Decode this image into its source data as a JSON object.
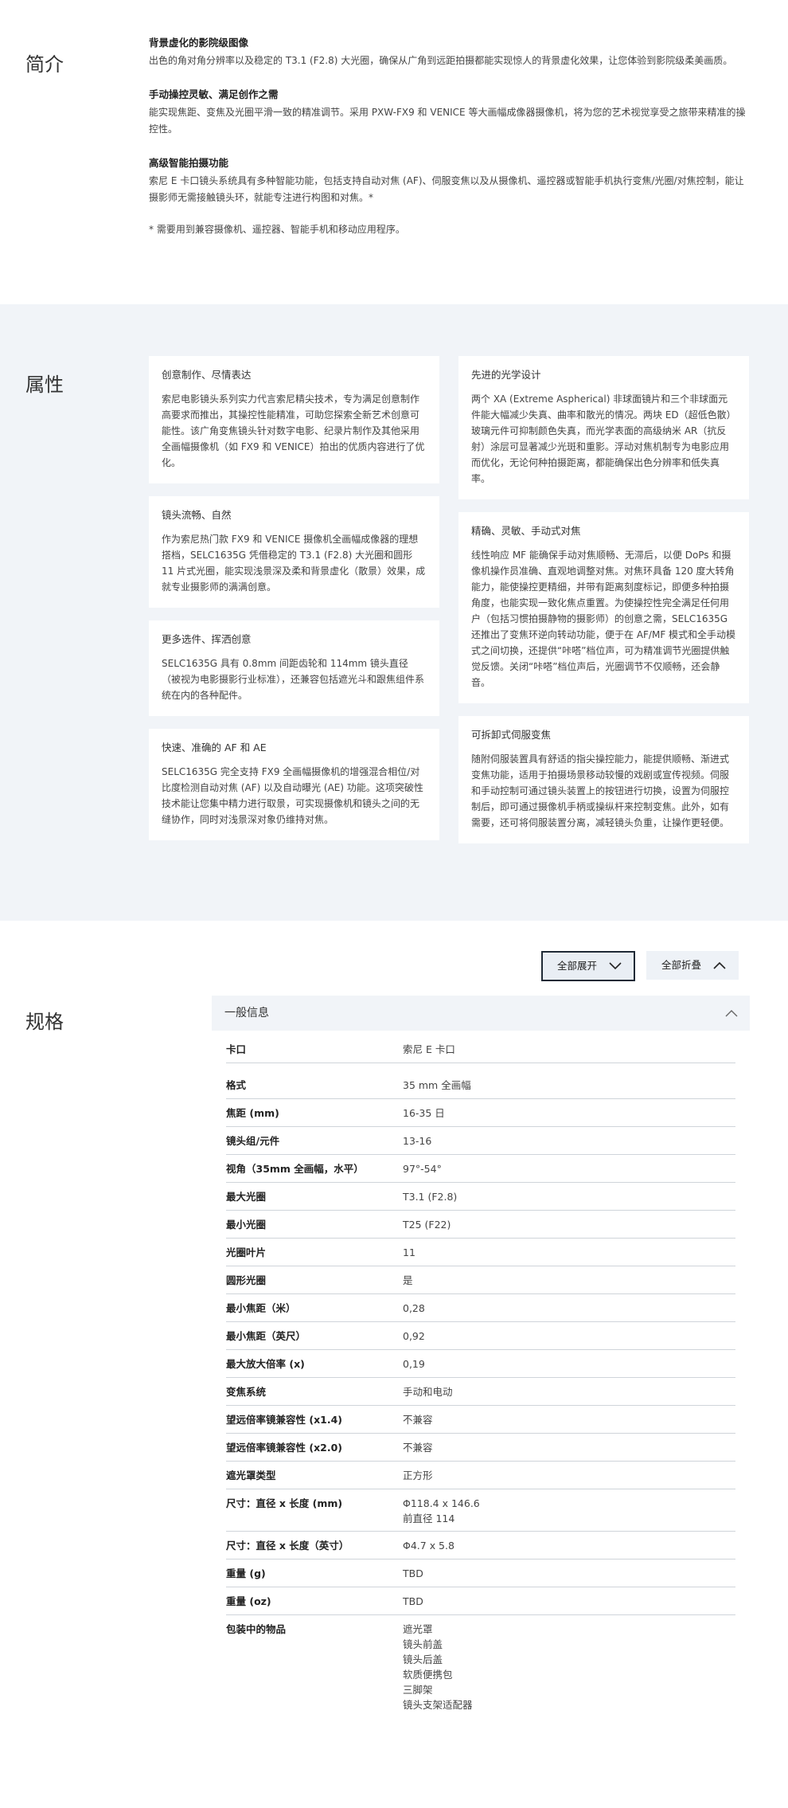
{
  "intro": {
    "title": "简介",
    "blocks": [
      {
        "heading": "背景虚化的影院级图像",
        "text": "出色的角对角分辨率以及稳定的 T3.1 (F2.8) 大光圈，确保从广角到远距拍摄都能实现惊人的背景虚化效果，让您体验到影院级柔美画质。"
      },
      {
        "heading": "手动操控灵敏、满足创作之需",
        "text": "能实现焦距、变焦及光圈平滑一致的精准调节。采用 PXW-FX9 和 VENICE 等大画幅成像器摄像机，将为您的艺术视觉享受之旅带来精准的操控性。"
      },
      {
        "heading": "高级智能拍摄功能",
        "text": "索尼 E 卡口镜头系统具有多种智能功能，包括支持自动对焦 (AF)、伺服变焦以及从摄像机、遥控器或智能手机执行变焦/光圈/对焦控制，能让摄影师无需接触镜头环，就能专注进行构图和对焦。*"
      }
    ],
    "footnote": "* 需要用到兼容摄像机、遥控器、智能手机和移动应用程序。"
  },
  "features": {
    "title": "属性",
    "left": [
      {
        "title": "创意制作、尽情表达",
        "text": "索尼电影镜头系列实力代言索尼精尖技术，专为满足创意制作高要求而推出，其操控性能精准，可助您探索全新艺术创意可能性。该广角变焦镜头针对数字电影、纪录片制作及其他采用全画幅摄像机（如 FX9 和 VENICE）拍出的优质内容进行了优化。"
      },
      {
        "title": "镜头流畅、自然",
        "text": "作为索尼热门款 FX9 和 VENICE 摄像机全画幅成像器的理想搭档，SELC1635G 凭借稳定的 T3.1 (F2.8) 大光圈和圆形 11 片式光圈，能实现浅景深及柔和背景虚化（散景）效果，成就专业摄影师的满满创意。"
      },
      {
        "title": "更多选件、挥洒创意",
        "text": "SELC1635G 具有 0.8mm 间距齿轮和 114mm 镜头直径（被视为电影摄影行业标准），还兼容包括遮光斗和跟焦组件系统在内的各种配件。"
      },
      {
        "title": "快速、准确的 AF 和 AE",
        "text": "SELC1635G 完全支持 FX9 全画幅摄像机的增强混合相位/对比度检测自动对焦 (AF) 以及自动曝光 (AE) 功能。这项突破性技术能让您集中精力进行取景，可实现摄像机和镜头之间的无缝协作，同时对浅景深对象仍维持对焦。"
      }
    ],
    "right": [
      {
        "title": "先进的光学设计",
        "text": "两个 XA (Extreme Aspherical) 非球面镜片和三个非球面元件能大幅减少失真、曲率和散光的情况。两块 ED（超低色散）玻璃元件可抑制颜色失真，而光学表面的高级纳米 AR（抗反射）涂层可显著减少光斑和重影。浮动对焦机制专为电影应用而优化，无论何种拍摄距离，都能确保出色分辨率和低失真率。"
      },
      {
        "title": "精确、灵敏、手动式对焦",
        "text": "线性响应 MF 能确保手动对焦顺畅、无滞后，以便 DoPs 和摄像机操作员准确、直观地调整对焦。对焦环具备 120 度大转角能力，能使操控更精细，并带有距离刻度标记，即便多种拍摄角度，也能实现一致化焦点重置。为使操控性完全满足任何用户（包括习惯拍摄静物的摄影师）的创意之需，SELC1635G 还推出了变焦环逆向转动功能，便于在 AF/MF 模式和全手动模式之间切换，还提供“咔嗒”档位声，可为精准调节光圈提供触觉反馈。关闭“咔嗒”档位声后，光圈调节不仅顺畅，还会静音。"
      },
      {
        "title": "可拆卸式伺服变焦",
        "text": "随附伺服装置具有舒适的指尖操控能力，能提供顺畅、渐进式变焦功能，适用于拍摄场景移动较慢的戏剧或宣传视频。伺服和手动控制可通过镜头装置上的按钮进行切换，设置为伺服控制后，即可通过摄像机手柄或操纵杆来控制变焦。此外，如有需要，还可将伺服装置分离，减轻镜头负重，让操作更轻便。"
      }
    ]
  },
  "specs": {
    "title": "规格",
    "expand_all": "全部展开",
    "collapse_all": "全部折叠",
    "group_title": "一般信息",
    "rows": [
      {
        "label": "卡口",
        "value": [
          "索尼 E 卡口"
        ]
      },
      {
        "label": "格式",
        "value": [
          "35 mm 全画幅"
        ]
      },
      {
        "label": "焦距 (mm)",
        "value": [
          "16-35 日"
        ]
      },
      {
        "label": "镜头组/元件",
        "value": [
          "13-16"
        ]
      },
      {
        "label": "视角（35mm 全画幅，水平）",
        "value": [
          "97°-54°"
        ]
      },
      {
        "label": "最大光圈",
        "value": [
          "T3.1 (F2.8)"
        ]
      },
      {
        "label": "最小光圈",
        "value": [
          "T25 (F22)"
        ]
      },
      {
        "label": "光圈叶片",
        "value": [
          "11"
        ]
      },
      {
        "label": "圆形光圈",
        "value": [
          "是"
        ]
      },
      {
        "label": "最小焦距（米）",
        "value": [
          "0,28"
        ]
      },
      {
        "label": "最小焦距（英尺）",
        "value": [
          "0,92"
        ]
      },
      {
        "label": "最大放大倍率 (x)",
        "value": [
          "0,19"
        ]
      },
      {
        "label": "变焦系统",
        "value": [
          "手动和电动"
        ]
      },
      {
        "label": "望远倍率镜兼容性 (x1.4)",
        "value": [
          "不兼容"
        ]
      },
      {
        "label": "望远倍率镜兼容性 (x2.0)",
        "value": [
          "不兼容"
        ]
      },
      {
        "label": "遮光罩类型",
        "value": [
          "正方形"
        ]
      },
      {
        "label": "尺寸：直径 x 长度 (mm)",
        "value": [
          "Φ118.4 x 146.6",
          "前直径 114"
        ]
      },
      {
        "label": "尺寸：直径 x 长度（英寸）",
        "value": [
          "Φ4.7 x 5.8"
        ]
      },
      {
        "label": "重量 (g)",
        "value": [
          "TBD"
        ]
      },
      {
        "label": "重量 (oz)",
        "value": [
          "TBD"
        ]
      },
      {
        "label": "包装中的物品",
        "value": [
          "遮光罩",
          "镜头前盖",
          "镜头后盖",
          "软质便携包",
          "三脚架",
          "镜头支架适配器"
        ]
      }
    ]
  }
}
